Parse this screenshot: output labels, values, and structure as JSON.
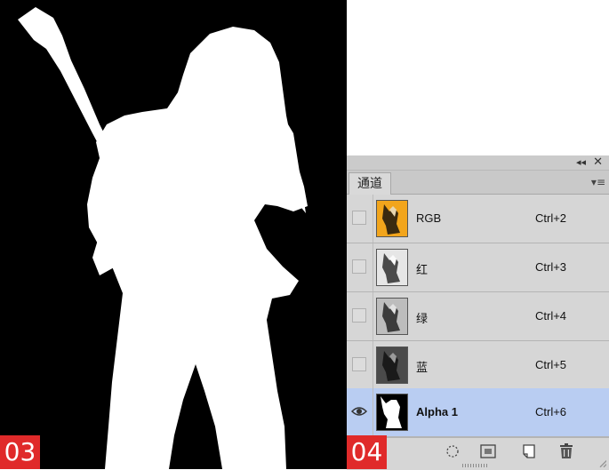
{
  "badges": {
    "left": "03",
    "right": "04"
  },
  "panel": {
    "tab_label": "通道",
    "collapse_glyph": "◂◂",
    "close_glyph": "✕",
    "menu_glyph": "▾≡"
  },
  "channels": [
    {
      "name": "RGB",
      "shortcut": "Ctrl+2",
      "visible": false,
      "selected": false
    },
    {
      "name": "红",
      "shortcut": "Ctrl+3",
      "visible": false,
      "selected": false
    },
    {
      "name": "绿",
      "shortcut": "Ctrl+4",
      "visible": false,
      "selected": false
    },
    {
      "name": "蓝",
      "shortcut": "Ctrl+5",
      "visible": false,
      "selected": false
    },
    {
      "name": "Alpha 1",
      "shortcut": "Ctrl+6",
      "visible": true,
      "selected": true
    }
  ],
  "colors": {
    "badge": "#e02a2a",
    "selected_row": "#b9cdf2",
    "panel_bg": "#d6d6d6",
    "rgb_thumb": "#f2a51c"
  }
}
